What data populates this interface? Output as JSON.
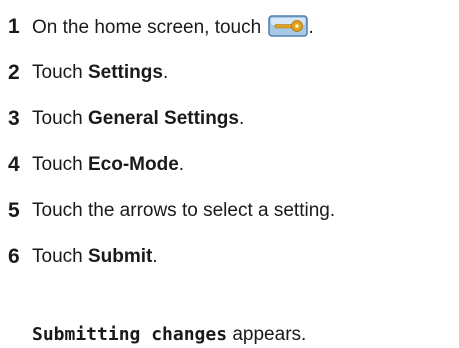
{
  "steps": [
    {
      "num": "1",
      "pre": "On the home screen, touch ",
      "bold": "",
      "post": ".",
      "icon": "key-icon"
    },
    {
      "num": "2",
      "pre": "Touch ",
      "bold": "Settings",
      "post": "."
    },
    {
      "num": "3",
      "pre": "Touch ",
      "bold": "General Settings",
      "post": "."
    },
    {
      "num": "4",
      "pre": "Touch ",
      "bold": "Eco-Mode",
      "post": "."
    },
    {
      "num": "5",
      "pre": "Touch the arrows to select a setting.",
      "bold": "",
      "post": ""
    },
    {
      "num": "6",
      "pre": "Touch ",
      "bold": "Submit",
      "post": "."
    }
  ],
  "result": {
    "code": "Submitting changes",
    "text": " appears."
  },
  "colors": {
    "icon_fill": "#a9c8e6",
    "icon_border": "#4f7fae",
    "key": "#e0a21e"
  }
}
